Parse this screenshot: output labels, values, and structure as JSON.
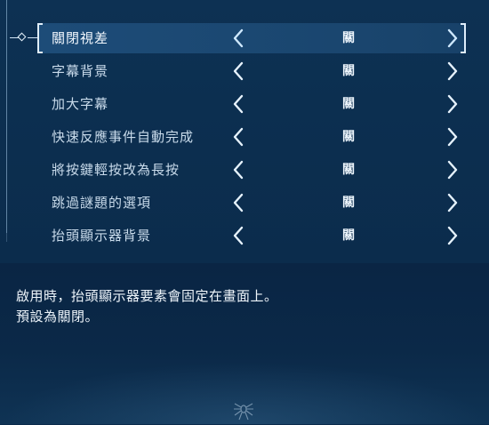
{
  "settings": {
    "items": [
      {
        "label": "關閉視差",
        "value": "關",
        "selected": true
      },
      {
        "label": "字幕背景",
        "value": "關",
        "selected": false
      },
      {
        "label": "加大字幕",
        "value": "關",
        "selected": false
      },
      {
        "label": "快速反應事件自動完成",
        "value": "關",
        "selected": false
      },
      {
        "label": "將按鍵輕按改為長按",
        "value": "關",
        "selected": false
      },
      {
        "label": "跳過謎題的選項",
        "value": "關",
        "selected": false
      },
      {
        "label": "抬頭顯示器背景",
        "value": "關",
        "selected": false
      }
    ]
  },
  "description": {
    "line1": "啟用時，抬頭顯示器要素會固定在畫面上。",
    "line2": "預設為關閉。"
  },
  "icons": {
    "arrow_left": "chevron-left-icon",
    "arrow_right": "chevron-right-icon",
    "focus_marker": "diamond-icon",
    "emblem": "spider-emblem-icon"
  },
  "colors": {
    "background": "#0b2b4c",
    "selected_row": "#1d4c78",
    "arrow": "#9fd3ff",
    "text": "#c9dbeb"
  }
}
